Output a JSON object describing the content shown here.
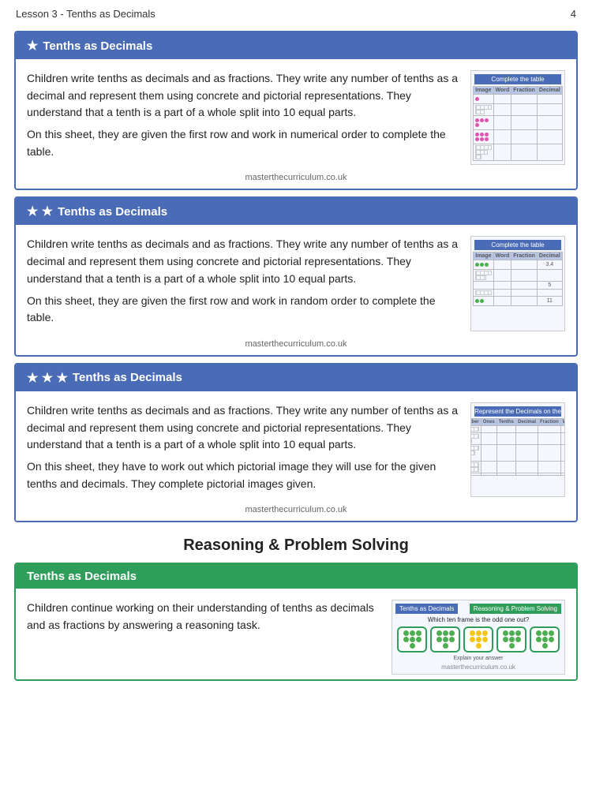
{
  "header": {
    "lesson": "Lesson 3 - Tenths as Decimals",
    "page": "4"
  },
  "cards": [
    {
      "id": "card1",
      "stars": 1,
      "title": "Tenths as Decimals",
      "body_p1": "Children write tenths as decimals and as fractions. They write any number of tenths as a decimal and represent them using concrete and pictorial representations. They understand that a tenth is a part of a whole split into 10 equal parts.",
      "body_p2": "On this sheet, they are given the first row and work in numerical order to complete the table.",
      "footer": "masterthecurriculum.co.uk"
    },
    {
      "id": "card2",
      "stars": 2,
      "title": "Tenths as Decimals",
      "body_p1": "Children write tenths as decimals and as fractions. They write any number of tenths as a decimal and represent them using concrete and pictorial representations. They understand that a tenth is a part of a whole split into 10 equal parts.",
      "body_p2": "On this sheet, they are given the first row and work in random order to complete the table.",
      "footer": "masterthecurriculum.co.uk"
    },
    {
      "id": "card3",
      "stars": 3,
      "title": "Tenths as Decimals",
      "body_p1": "Children write tenths as decimals and as fractions. They write any number of tenths as a decimal and represent them using concrete and pictorial representations. They understand that a tenth is a part of a whole split into 10 equal parts.",
      "body_p2": "On this sheet, they have to work out which pictorial image they will use for the given tenths and decimals. They complete pictorial images given.",
      "footer": "masterthecurriculum.co.uk"
    }
  ],
  "reasoning_section": {
    "title": "Reasoning & Problem Solving",
    "card": {
      "title": "Tenths as Decimals",
      "body": "Children continue working on their understanding of tenths as decimals and as fractions by answering a reasoning task.",
      "thumb_label_left": "Tenths as Decimals",
      "thumb_label_right": "Reasoning & Problem Solving",
      "question": "Which ten frame is the odd one out?",
      "explain": "Explain your answer",
      "footer": "masterthecurriculum.co.uk"
    }
  },
  "labels": {
    "star": "★",
    "star2": "★ ★",
    "star3": "★ ★ ★"
  }
}
